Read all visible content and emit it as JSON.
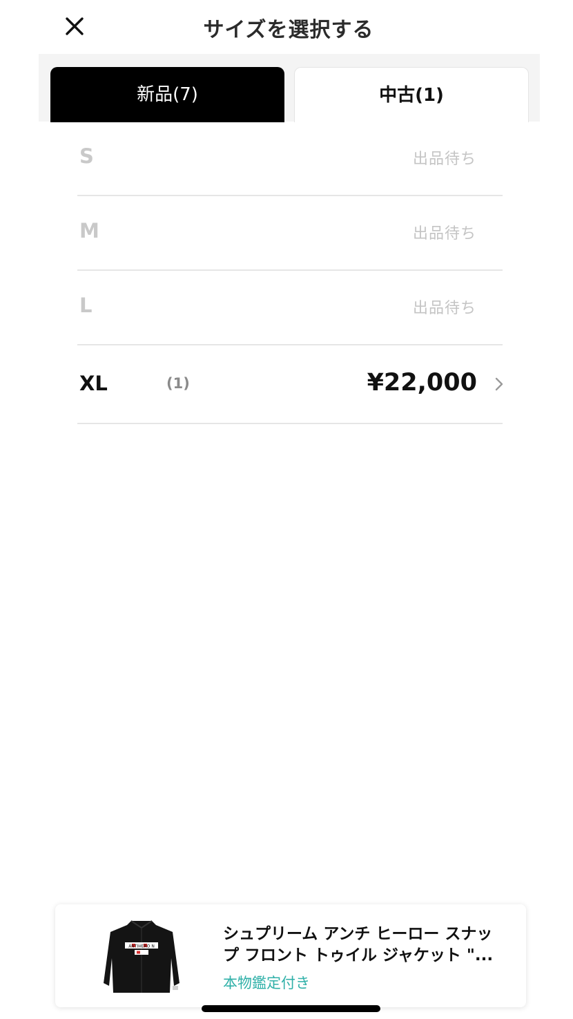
{
  "header": {
    "title": "サイズを選択する",
    "close_icon": "close-icon"
  },
  "tabs": [
    {
      "label": "新品(7)",
      "selected": true
    },
    {
      "label": "中古(1)",
      "selected": false
    }
  ],
  "sizes": [
    {
      "label": "S",
      "status": "出品待ち"
    },
    {
      "label": "M",
      "status": "出品待ち"
    },
    {
      "label": "L",
      "status": "出品待ち"
    },
    {
      "label": "XL",
      "count": "(1)",
      "price": "¥22,000"
    }
  ],
  "product": {
    "title": "シュプリーム アンチ ヒーロー スナップ フロント トゥイル ジャケット \"...",
    "badge": "本物鑑定付き",
    "thumb_logo_text": "ANTIHERO N"
  },
  "colors": {
    "accent_teal": "#2fb0a8",
    "tab_selected_bg": "#000000",
    "disabled_text": "#c9c9c9"
  }
}
